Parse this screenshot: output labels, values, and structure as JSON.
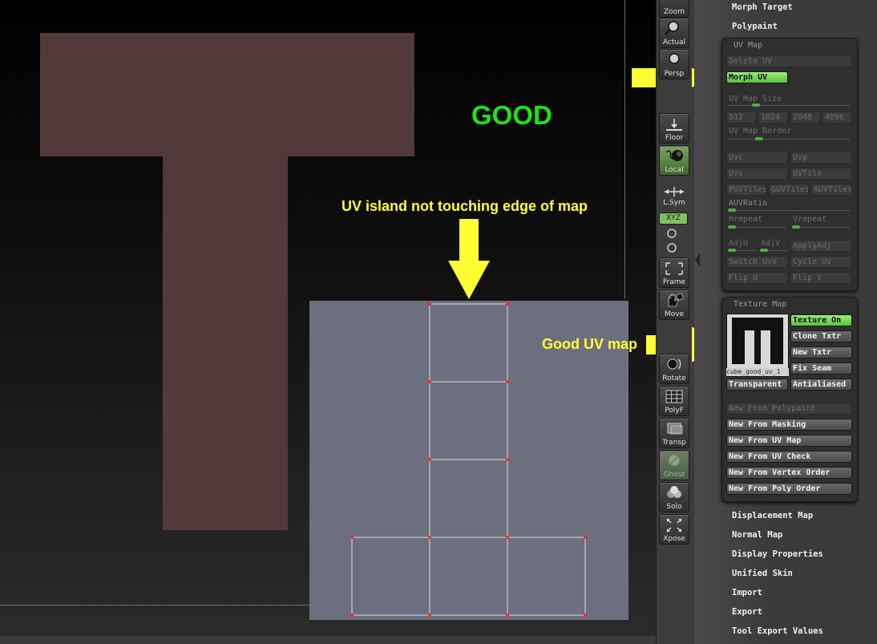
{
  "viewport": {
    "good_label": "GOOD",
    "uv_island_caption": "UV island not touching edge of map",
    "good_uv_caption": "Good UV map",
    "colors": {
      "mesh": "#523a3a",
      "annotation_arrow": "#ffff33",
      "good_text": "#19e519",
      "uv_background": "#6c707e",
      "uv_vertex": "#ff2a2a"
    }
  },
  "toolbar": {
    "buttons": [
      {
        "label": "Zoom",
        "icon": "magnifier-icon"
      },
      {
        "label": "Actual",
        "icon": "magnifier-icon"
      },
      {
        "label": "Persp",
        "icon": "perspective-icon"
      },
      {
        "label": "Floor",
        "icon": "floor-icon"
      },
      {
        "label": "Local",
        "icon": "local-icon",
        "active": true
      },
      {
        "label": "L.Sym",
        "icon": "local-symmetry-icon"
      },
      {
        "label": "XYZ",
        "icon": "xyz-icon",
        "active": true
      },
      {
        "label": "Frame",
        "icon": "frame-icon"
      },
      {
        "label": "Move",
        "icon": "move-hand-icon"
      },
      {
        "label": "Rotate",
        "icon": "rotate-icon"
      },
      {
        "label": "PolyF",
        "icon": "polyframe-icon"
      },
      {
        "label": "Transp",
        "icon": "transparent-icon"
      },
      {
        "label": "Ghost",
        "icon": "ghost-icon"
      },
      {
        "label": "Solo",
        "icon": "solo-icon"
      },
      {
        "label": "Xpose",
        "icon": "xpose-icon"
      }
    ]
  },
  "menu_top": {
    "morph_target": "Morph Target",
    "polypaint": "Polypaint"
  },
  "uv_map": {
    "title": "UV Map",
    "delete_uv": "Delete UV",
    "morph_uv": "Morph UV",
    "map_size_label": "UV Map Size",
    "sizes": [
      "512",
      "1024",
      "2048",
      "4096"
    ],
    "border_label": "UV Map Border",
    "uvc": "Uvc",
    "uvp": "Uvp",
    "uvs": "Uvs",
    "uvtile": "UVTile",
    "puvtiles": "PUVTiles",
    "guvtiles": "GUVTiles",
    "auvtiles": "AUVTiles",
    "auvratio": "AUVRatio",
    "hrepeat": "Hrepeat",
    "vrepeat": "Vrepeat",
    "adju": "AdjU",
    "adjv": "AdjV",
    "applyadj": "ApplyAdj",
    "switch_uv": "Switch U◇V",
    "cycle_uv": "Cycle UV",
    "flip_u": "Flip U",
    "flip_v": "Flip V"
  },
  "texture_map": {
    "title": "Texture Map",
    "thumbnail_name": "cube_good_uv_1",
    "texture_on": "Texture On",
    "clone_txtr": "Clone Txtr",
    "new_txtr": "New Txtr",
    "fix_seam": "Fix Seam",
    "transparent": "Transparent",
    "antialiased": "Antialiased",
    "new_from_polypaint": "New From Polypaint",
    "new_from_masking": "New From Masking",
    "new_from_uv_map": "New From UV Map",
    "new_from_uv_check": "New From UV Check",
    "new_from_vertex_order": "New From Vertex Order",
    "new_from_poly_order": "New From Poly Order"
  },
  "menu_bottom": [
    "Displacement Map",
    "Normal Map",
    "Display Properties",
    "Unified Skin",
    "Import",
    "Export",
    "Tool Export Values"
  ]
}
